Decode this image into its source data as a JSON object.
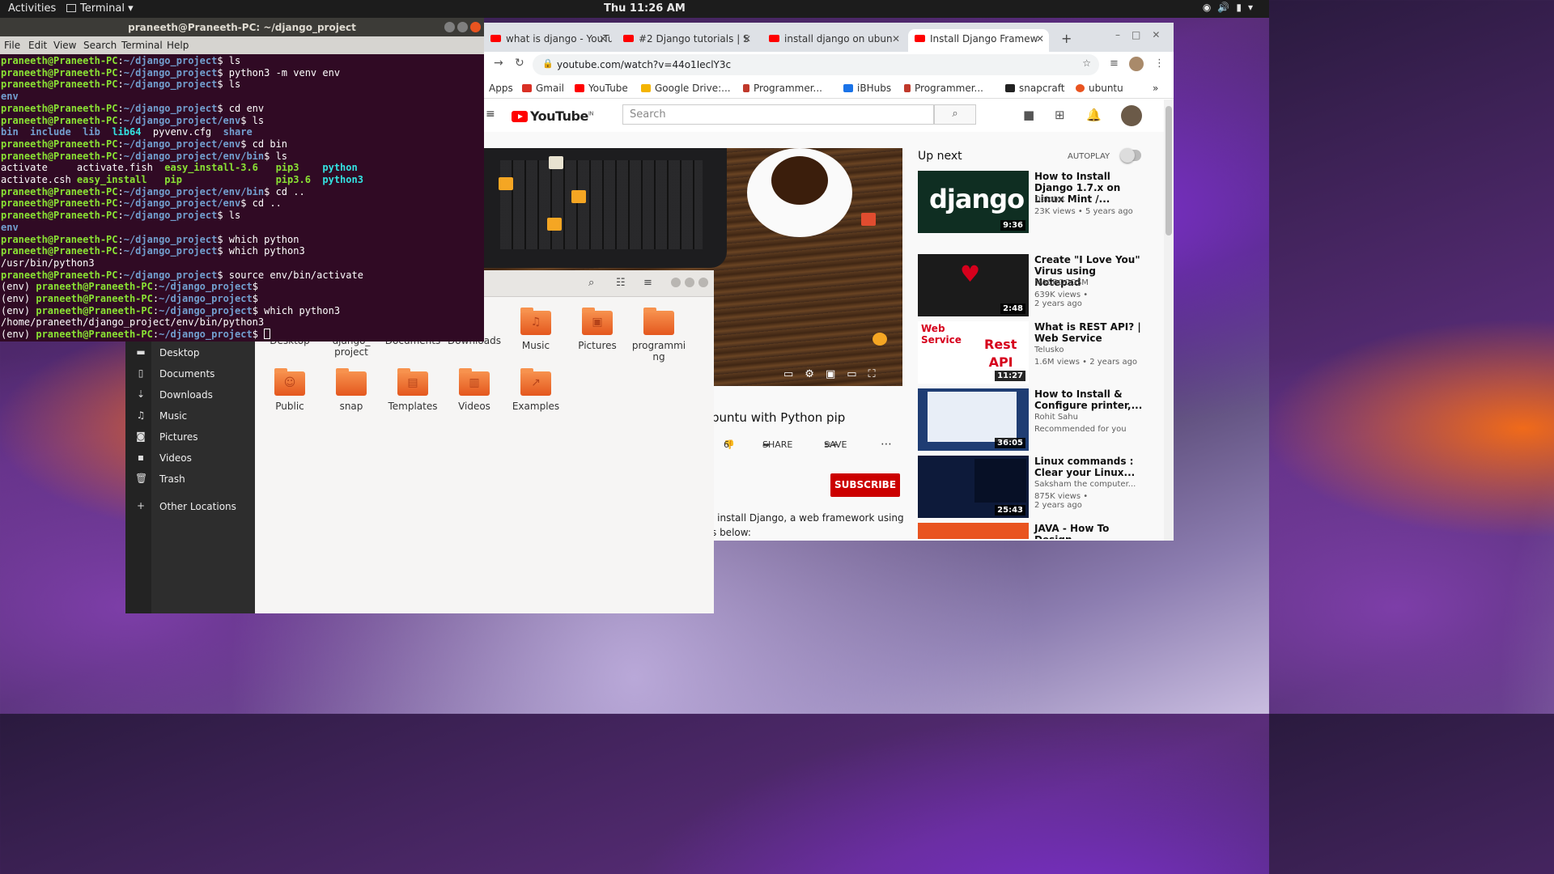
{
  "topbar": {
    "activities": "Activities",
    "app": "Terminal",
    "clock": "Thu 11:26 AM"
  },
  "terminal": {
    "title": "praneeth@Praneeth-PC: ~/django_project",
    "menu": [
      "File",
      "Edit",
      "View",
      "Search",
      "Terminal",
      "Help"
    ],
    "prompt_user": "praneeth@Praneeth-PC",
    "lines": [
      {
        "type": "cmd",
        "path": "~/django_project",
        "cmd": "ls"
      },
      {
        "type": "cmd",
        "path": "~/django_project",
        "cmd": "python3 -m venv env"
      },
      {
        "type": "cmd",
        "path": "~/django_project",
        "cmd": "ls"
      },
      {
        "type": "dir",
        "text": "env"
      },
      {
        "type": "cmd",
        "path": "~/django_project",
        "cmd": "cd env"
      },
      {
        "type": "cmd",
        "path": "~/django_project/env",
        "cmd": "ls"
      },
      {
        "type": "dirs",
        "items": [
          "bin",
          "include",
          "lib",
          "lib64",
          "pyvenv.cfg",
          "share"
        ]
      },
      {
        "type": "cmd",
        "path": "~/django_project/env",
        "cmd": "cd bin"
      },
      {
        "type": "cmd",
        "path": "~/django_project/env/bin",
        "cmd": "ls"
      },
      {
        "type": "ls1",
        "items": [
          "activate",
          "activate.fish",
          "easy_install-3.6",
          "pip3",
          "python"
        ]
      },
      {
        "type": "ls2",
        "items": [
          "activate.csh",
          "easy_install",
          "pip",
          "pip3.6",
          "python3"
        ]
      },
      {
        "type": "cmd",
        "path": "~/django_project/env/bin",
        "cmd": "cd .."
      },
      {
        "type": "cmd",
        "path": "~/django_project/env",
        "cmd": "cd .."
      },
      {
        "type": "cmd",
        "path": "~/django_project",
        "cmd": "ls"
      },
      {
        "type": "dir",
        "text": "env"
      },
      {
        "type": "cmd",
        "path": "~/django_project",
        "cmd": "which python"
      },
      {
        "type": "cmd",
        "path": "~/django_project",
        "cmd": "which python3"
      },
      {
        "type": "out",
        "text": "/usr/bin/python3"
      },
      {
        "type": "cmd",
        "path": "~/django_project",
        "cmd": "source env/bin/activate"
      },
      {
        "type": "envcmd",
        "path": "~/django_project",
        "cmd": ""
      },
      {
        "type": "envcmd",
        "path": "~/django_project",
        "cmd": ""
      },
      {
        "type": "envcmd",
        "path": "~/django_project",
        "cmd": "which python3"
      },
      {
        "type": "out",
        "text": "/home/praneeth/django_project/env/bin/python3"
      },
      {
        "type": "envcursor",
        "path": "~/django_project"
      }
    ]
  },
  "browser": {
    "tabs": [
      {
        "label": "what is django - YouTu"
      },
      {
        "label": "#2 Django tutorials | S"
      },
      {
        "label": "install django on ubun"
      },
      {
        "label": "Install Django Framew"
      }
    ],
    "url": "youtube.com/watch?v=44o1IeclY3c",
    "bookmarks": [
      "Apps",
      "Gmail",
      "YouTube",
      "Google Drive:...",
      "Programmer...",
      "iBHubs",
      "Programmer...",
      "snapcraft",
      "ubuntu"
    ],
    "bookmark_more": "»"
  },
  "youtube": {
    "logo": "YouTube",
    "logo_region": "IN",
    "search_placeholder": "Search",
    "video_title": "buntu with Python pip",
    "dislikes": "6",
    "share_label": "SHARE",
    "save_label": "SAVE",
    "subscribe_label": "SUBSCRIBE",
    "description": [
      "l install Django, a web framework using",
      "s below:"
    ],
    "up_next_label": "Up next",
    "autoplay_label": "AUTOPLAY",
    "cards": [
      {
        "title": "How to Install Django 1.7.x on Linux Mint /...",
        "channel": "Dototot",
        "meta": "23K views • 5 years ago",
        "duration": "9:36",
        "thumb": "django"
      },
      {
        "title": "Create \"I Love You\" Virus using Notepad",
        "channel": "MACROCOSM",
        "meta": "639K views •",
        "meta2": "2 years ago",
        "duration": "2:48"
      },
      {
        "title": "What is REST API? | Web Service",
        "channel": "Telusko",
        "meta": "1.6M views • 2 years ago",
        "duration": "11:27"
      },
      {
        "title": "How to Install & Configure printer,...",
        "channel": "Rohit Sahu",
        "meta": "Recommended for you",
        "duration": "36:05"
      },
      {
        "title": "Linux commands : Clear your Linux...",
        "channel": "Saksham the computer...",
        "meta": "875K views •",
        "meta2": "2 years ago",
        "duration": "25:43"
      },
      {
        "title": "JAVA - How To Design",
        "channel": "",
        "meta": "",
        "duration": ""
      }
    ]
  },
  "files": {
    "sidebar": [
      {
        "label": "Desktop",
        "icon": "folder-icon"
      },
      {
        "label": "Documents",
        "icon": "document-icon"
      },
      {
        "label": "Downloads",
        "icon": "download-icon"
      },
      {
        "label": "Music",
        "icon": "music-icon"
      },
      {
        "label": "Pictures",
        "icon": "camera-icon"
      },
      {
        "label": "Videos",
        "icon": "video-icon"
      },
      {
        "label": "Trash",
        "icon": "trash-icon"
      },
      {
        "label": "Other Locations",
        "icon": "plus-icon"
      }
    ],
    "row0": [
      "Desktop",
      "django_\nproject",
      "Documents",
      "Downloads"
    ],
    "folders_row1": [
      {
        "label": "Music",
        "glyph": "♫"
      },
      {
        "label": "Pictures",
        "glyph": "▣"
      },
      {
        "label": "programmi\nng",
        "glyph": ""
      }
    ],
    "folders_row2": [
      {
        "label": "Public",
        "glyph": "☺"
      },
      {
        "label": "snap",
        "glyph": ""
      },
      {
        "label": "Templates",
        "glyph": "▤"
      },
      {
        "label": "Videos",
        "glyph": "▥"
      },
      {
        "label": "Examples",
        "glyph": "↗"
      }
    ]
  }
}
